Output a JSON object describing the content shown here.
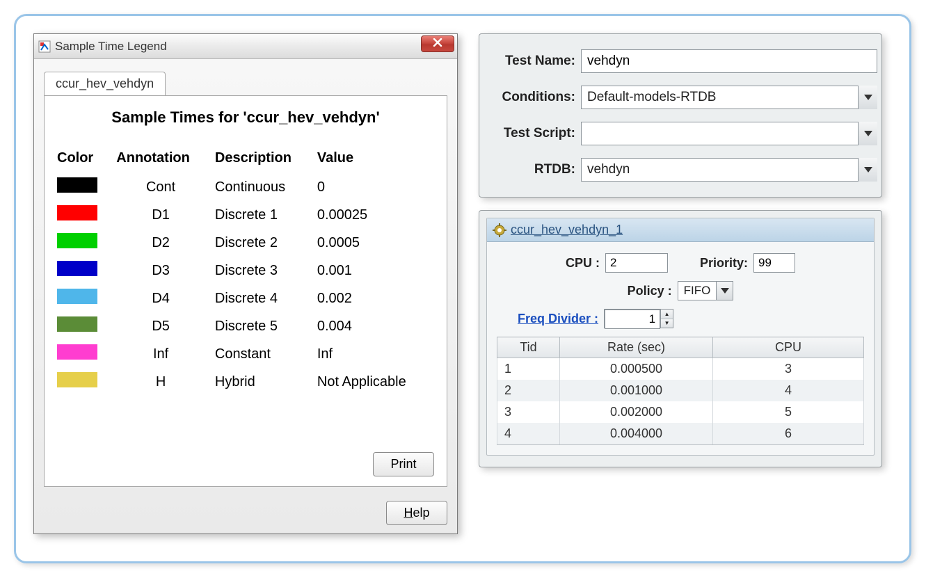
{
  "legend_window": {
    "title": "Sample Time Legend",
    "tab": "ccur_hev_vehdyn",
    "heading": "Sample Times for 'ccur_hev_vehdyn'",
    "columns": {
      "c1": "Color",
      "c2": "Annotation",
      "c3": "Description",
      "c4": "Value"
    },
    "rows": [
      {
        "color": "#000000",
        "annotation": "Cont",
        "description": "Continuous",
        "value": "0"
      },
      {
        "color": "#ff0000",
        "annotation": "D1",
        "description": "Discrete 1",
        "value": "0.00025"
      },
      {
        "color": "#00d000",
        "annotation": "D2",
        "description": "Discrete 2",
        "value": "0.0005"
      },
      {
        "color": "#0000c8",
        "annotation": "D3",
        "description": "Discrete 3",
        "value": "0.001"
      },
      {
        "color": "#4fb6ea",
        "annotation": "D4",
        "description": "Discrete 4",
        "value": "0.002"
      },
      {
        "color": "#5b8c37",
        "annotation": "D5",
        "description": "Discrete 5",
        "value": "0.004"
      },
      {
        "color": "#ff3dd0",
        "annotation": "Inf",
        "description": "Constant",
        "value": "Inf"
      },
      {
        "color": "#e6cf4a",
        "annotation": "H",
        "description": "Hybrid",
        "value": "Not Applicable"
      }
    ],
    "print_label": "Print",
    "help_label": "Help"
  },
  "form": {
    "labels": {
      "test_name": "Test Name:",
      "conditions": "Conditions:",
      "test_script": "Test Script:",
      "rtdb": "RTDB:"
    },
    "values": {
      "test_name": "vehdyn",
      "conditions": "Default-models-RTDB",
      "test_script": "",
      "rtdb": "vehdyn"
    }
  },
  "task": {
    "header": "ccur_hev_vehdyn_1",
    "labels": {
      "cpu": "CPU :",
      "priority": "Priority:",
      "policy": "Policy :",
      "freq_divider": "Freq Divider :"
    },
    "values": {
      "cpu": "2",
      "priority": "99",
      "policy": "FIFO",
      "freq_divider": "1"
    },
    "table_headers": {
      "tid": "Tid",
      "rate": "Rate (sec)",
      "cpu": "CPU"
    },
    "rows": [
      {
        "tid": "1",
        "rate": "0.000500",
        "cpu": "3"
      },
      {
        "tid": "2",
        "rate": "0.001000",
        "cpu": "4"
      },
      {
        "tid": "3",
        "rate": "0.002000",
        "cpu": "5"
      },
      {
        "tid": "4",
        "rate": "0.004000",
        "cpu": "6"
      }
    ]
  }
}
